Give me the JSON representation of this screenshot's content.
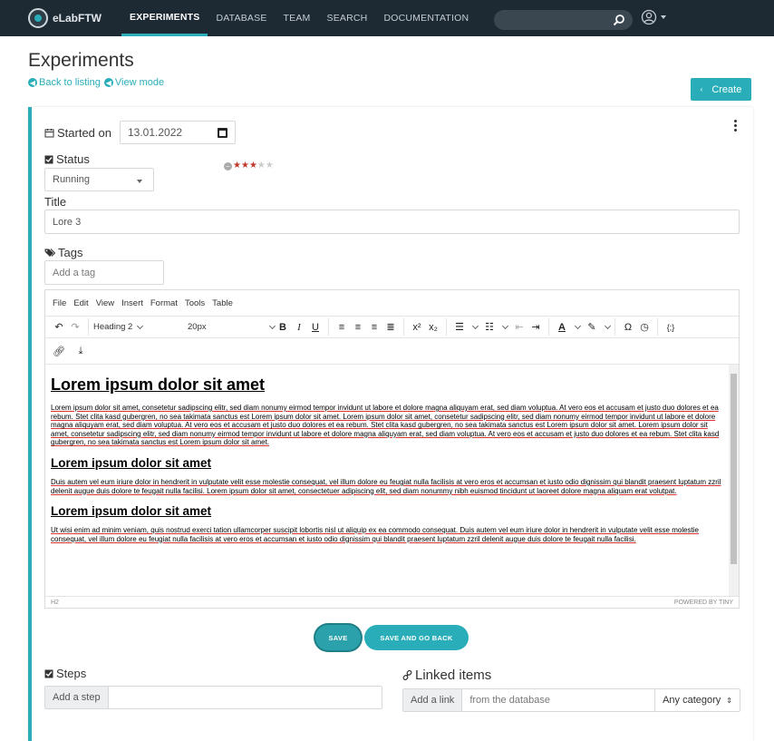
{
  "nav": {
    "brand": "eLabFTW",
    "links": [
      "EXPERIMENTS",
      "DATABASE",
      "TEAM",
      "SEARCH",
      "DOCUMENTATION"
    ]
  },
  "header": {
    "title": "Experiments",
    "back_link": "Back to listing",
    "view_link": "View mode",
    "create_label": "Create"
  },
  "form": {
    "started_label": "Started on",
    "started_value": "13.01.2022",
    "status_label": "Status",
    "status_value": "Running",
    "rating": 3,
    "rating_max": 5,
    "title_label": "Title",
    "title_value": "Lore 3",
    "tags_label": "Tags",
    "tags_placeholder": "Add a tag"
  },
  "editor": {
    "menu": [
      "File",
      "Edit",
      "View",
      "Insert",
      "Format",
      "Tools",
      "Table"
    ],
    "block_format": "Heading 2",
    "font_size": "20px",
    "content": {
      "h1": "Lorem ipsum dolor sit amet",
      "p1": "Lorem ipsum dolor sit amet, consetetur sadipscing elitr, sed diam nonumy eirmod tempor invidunt ut labore et dolore magna aliquyam erat, sed diam voluptua. At vero eos et accusam et justo duo dolores et ea rebum. Stet clita kasd gubergren, no sea takimata sanctus est Lorem ipsum dolor sit amet. Lorem ipsum dolor sit amet, consetetur sadipscing elitr, sed diam nonumy eirmod tempor invidunt ut labore et dolore magna aliquyam erat, sed diam voluptua. At vero eos et accusam et justo duo dolores et ea rebum. Stet clita kasd gubergren, no sea takimata sanctus est Lorem ipsum dolor sit amet. Lorem ipsum dolor sit amet, consetetur sadipscing elitr, sed diam nonumy eirmod tempor invidunt ut labore et dolore magna aliquyam erat, sed diam voluptua. At vero eos et accusam et justo duo dolores et ea rebum. Stet clita kasd gubergren, no sea takimata sanctus est Lorem ipsum dolor sit amet.",
      "h2a": "Lorem ipsum dolor sit amet",
      "p2": "Duis autem vel eum iriure dolor in hendrerit in vulputate velit esse molestie consequat, vel illum dolore eu feugiat nulla facilisis at vero eros et accumsan et iusto odio dignissim qui blandit praesent luptatum zzril delenit augue duis dolore te feugait nulla facilisi. Lorem ipsum dolor sit amet, consectetuer adipiscing elit, sed diam nonummy nibh euismod tincidunt ut laoreet dolore magna aliquam erat volutpat.",
      "h2b": "Lorem ipsum dolor sit amet",
      "p3": "Ut wisi enim ad minim veniam, quis nostrud exerci tation ullamcorper suscipit lobortis nisl ut aliquip ex ea commodo consequat. Duis autem vel eum iriure dolor in hendrerit in vulputate velit esse molestie consequat, vel illum dolore eu feugiat nulla facilisis at vero eros et accumsan et iusto odio dignissim qui blandit praesent luptatum zzril delenit augue duis dolore te feugait nulla facilisi."
    },
    "status_path": "H2",
    "branding": "POWERED BY TINY"
  },
  "actions": {
    "save": "SAVE",
    "save_back": "SAVE AND GO BACK"
  },
  "steps": {
    "label": "Steps",
    "addon": "Add a step"
  },
  "links": {
    "label": "Linked items",
    "addon": "Add a link",
    "placeholder": "from the database",
    "category": "Any category"
  },
  "colors": {
    "accent": "#29aeb9",
    "nav_bg": "#1e2a33",
    "star_on": "#c0392b"
  }
}
